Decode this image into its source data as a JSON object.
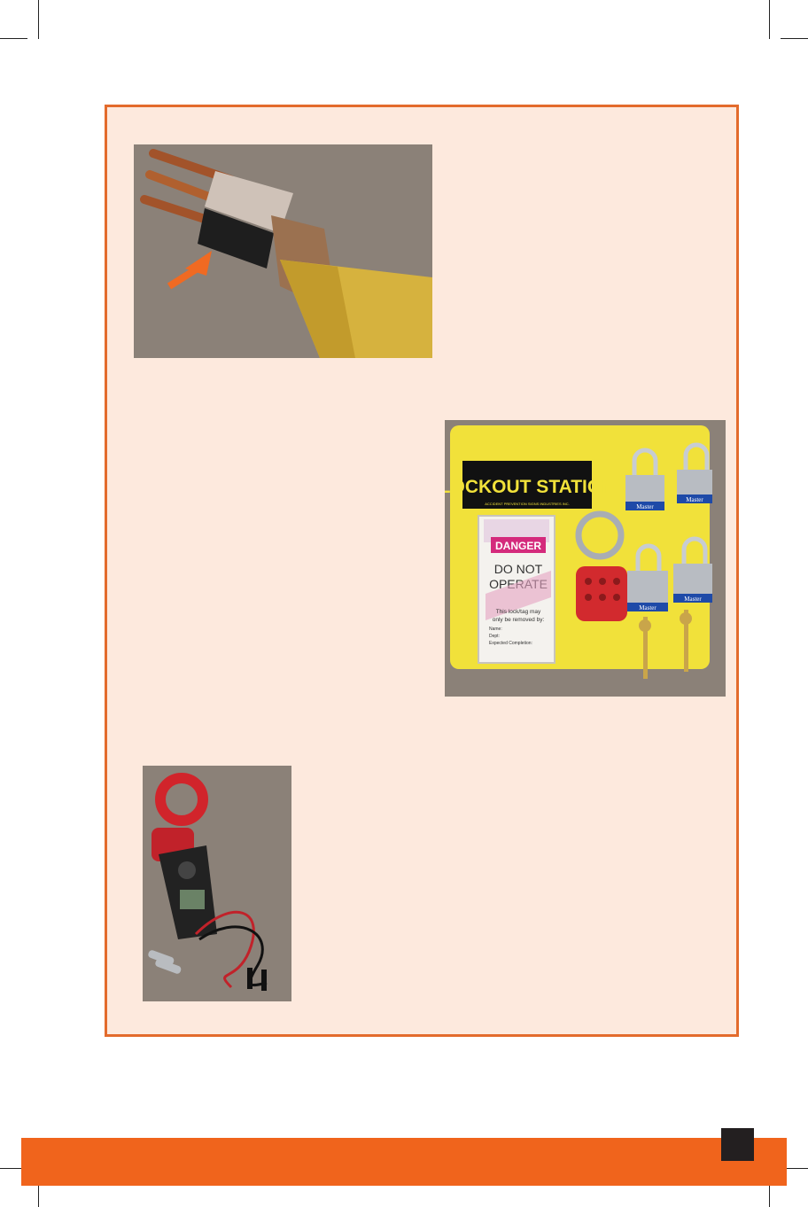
{
  "colors": {
    "panel_border": "#e36b2c",
    "panel_fill": "#fde9dd",
    "photo_background": "#8b8178",
    "footer_band": "#f0641c",
    "page_box": "#231f20"
  },
  "lockout_station": {
    "sign_title": "LOCKOUT STATION",
    "sign_fine_print": "ACCIDENT PREVENTION SIGNS INDUSTRIES INC.",
    "tag_header": "DANGER",
    "tag_line1": "DO NOT",
    "tag_line2": "OPERATE",
    "tag_removal_line1": "This lock/tag may",
    "tag_removal_line2": "only be removed by:",
    "tag_name_label": "Name:",
    "tag_dept_label": "Dept:",
    "tag_completion_label": "Expected Completion:",
    "padlock_brand": "Master"
  }
}
